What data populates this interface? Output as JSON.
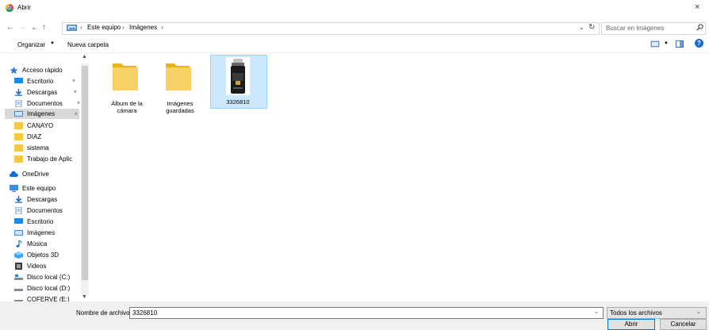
{
  "window": {
    "title": "Abrir",
    "close_glyph": "×"
  },
  "nav": {
    "back": "←",
    "forward": "→",
    "recent": "⌄",
    "up": "↑",
    "breadcrumb_sep": "›",
    "breadcrumb": [
      "Este equipo",
      "Imágenes"
    ],
    "dropdown": "⌄",
    "refresh": "↻",
    "search_placeholder": "Buscar en Imágenes"
  },
  "toolbar": {
    "organize": "Organizar",
    "organize_caret": "▼",
    "new_folder": "Nueva carpeta",
    "view_caret": "▼",
    "help": "?"
  },
  "sidebar": {
    "pin_glyph": "✶",
    "items": [
      {
        "label": "Acceso rápido",
        "icon": "star-icon"
      },
      {
        "label": "Escritorio",
        "icon": "desktop-icon",
        "pinned": true
      },
      {
        "label": "Descargas",
        "icon": "download-icon",
        "pinned": true
      },
      {
        "label": "Documentos",
        "icon": "documents-icon",
        "pinned": true
      },
      {
        "label": "Imágenes",
        "icon": "pictures-icon",
        "pinned": true,
        "selected": true
      },
      {
        "label": "CANAYO",
        "icon": "folder-icon"
      },
      {
        "label": "DIAZ",
        "icon": "folder-icon"
      },
      {
        "label": "sistema",
        "icon": "folder-icon"
      },
      {
        "label": "Trabajo de Aplic",
        "icon": "folder-icon"
      },
      {
        "label": "OneDrive",
        "icon": "cloud-icon"
      },
      {
        "label": "Este equipo",
        "icon": "computer-icon"
      },
      {
        "label": "Descargas",
        "icon": "download-icon"
      },
      {
        "label": "Documentos",
        "icon": "documents-icon"
      },
      {
        "label": "Escritorio",
        "icon": "desktop-icon"
      },
      {
        "label": "Imágenes",
        "icon": "pictures-icon"
      },
      {
        "label": "Música",
        "icon": "music-icon"
      },
      {
        "label": "Objetos 3D",
        "icon": "objects3d-icon"
      },
      {
        "label": "Videos",
        "icon": "video-icon"
      },
      {
        "label": "Disco local (C:)",
        "icon": "drive-c-icon"
      },
      {
        "label": "Disco local (D:)",
        "icon": "drive-icon"
      },
      {
        "label": "COFERVE (E:)",
        "icon": "drive-icon"
      }
    ],
    "scroll_up": "▲",
    "scroll_down": "▼"
  },
  "files": [
    {
      "label": "Álbum de la cámara",
      "type": "folder"
    },
    {
      "label": "Imágenes guardadas",
      "type": "folder"
    },
    {
      "label": "3326810",
      "type": "image",
      "selected": true
    }
  ],
  "footer": {
    "filename_label": "Nombre de archivo:",
    "filename_value": "3326810",
    "combo_caret": "⌄",
    "filter": "Todos los archivos",
    "filter_caret": "⌄",
    "open": "Abrir",
    "cancel": "Cancelar"
  },
  "colors": {
    "accent": "#0078d7",
    "selection": "#cce8ff",
    "folder": "#f5c842"
  }
}
